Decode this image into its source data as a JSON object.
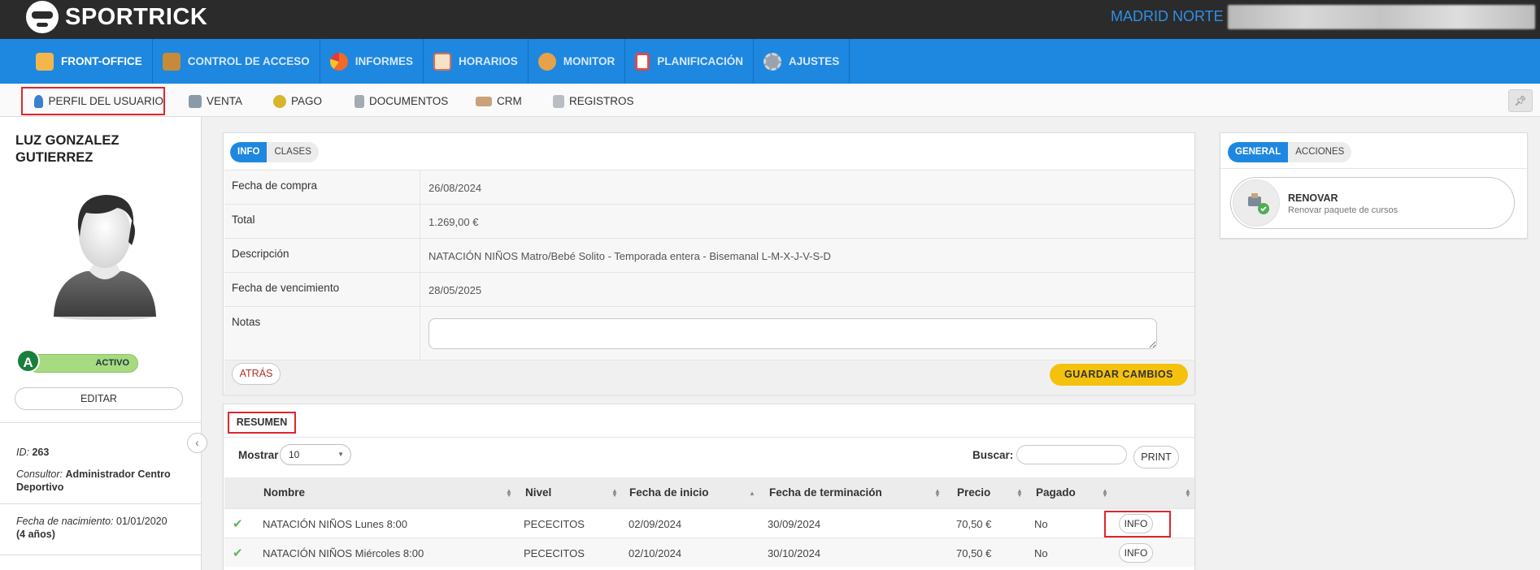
{
  "app": {
    "logo_text": "SPORTRICK",
    "site": "MADRID NORTE"
  },
  "main_nav": [
    {
      "label": "FRONT-OFFICE",
      "icon": "front-office-icon",
      "color": "#f2b64c"
    },
    {
      "label": "CONTROL DE ACCESO",
      "icon": "access-control-icon",
      "color": "#c58b3a"
    },
    {
      "label": "INFORMES",
      "icon": "pie-chart-icon",
      "color": "#f26a2a"
    },
    {
      "label": "HORARIOS",
      "icon": "calendar-icon",
      "color": "#e46b4b"
    },
    {
      "label": "MONITOR",
      "icon": "people-icon",
      "color": "#e6a24a"
    },
    {
      "label": "PLANIFICACIÓN",
      "icon": "planner-icon",
      "color": "#e04a4a"
    },
    {
      "label": "AJUSTES",
      "icon": "gear-icon",
      "color": "#9aa3ad"
    }
  ],
  "sub_nav": [
    {
      "label": "PERFIL DEL USUARIO",
      "icon": "user-profile-icon"
    },
    {
      "label": "VENTA",
      "icon": "sale-icon"
    },
    {
      "label": "PAGO",
      "icon": "coin-icon"
    },
    {
      "label": "DOCUMENTOS",
      "icon": "document-icon"
    },
    {
      "label": "CRM",
      "icon": "handshake-icon"
    },
    {
      "label": "REGISTROS",
      "icon": "records-icon"
    }
  ],
  "user": {
    "name": "LUZ GONZALEZ GUTIERREZ",
    "status_letter": "A",
    "status": "ACTIVO",
    "edit_label": "EDITAR",
    "id_label": "ID:",
    "id": "263",
    "consultant_label": "Consultor:",
    "consultant": "Administrador Centro Deportivo",
    "birth_label": "Fecha de nacimiento:",
    "birth_date": "01/01/2020",
    "age": "(4 años)"
  },
  "info_card": {
    "tabs": [
      "INFO",
      "CLASES"
    ],
    "rows": [
      {
        "label": "Fecha de compra",
        "value": "26/08/2024"
      },
      {
        "label": "Total",
        "value": "1.269,00 €"
      },
      {
        "label": "Descripción",
        "value": "NATACIÓN NIÑOS Matro/Bebé Solito - Temporada entera - Bisemanal L-M-X-J-V-S-D"
      },
      {
        "label": "Fecha de vencimiento",
        "value": "28/05/2025"
      }
    ],
    "notes_label": "Notas",
    "notes_value": "",
    "back_label": "ATRÁS",
    "save_label": "GUARDAR CAMBIOS"
  },
  "summary": {
    "title": "RESUMEN",
    "show_label": "Mostrar",
    "page_size": "10",
    "search_label": "Buscar:",
    "search_value": "",
    "print_label": "PRINT",
    "columns": [
      "Nombre",
      "Nivel",
      "Fecha de inicio",
      "Fecha de terminación",
      "Precio",
      "Pagado"
    ],
    "rows": [
      {
        "nombre": "NATACIÓN NIÑOS Lunes 8:00",
        "nivel": "PECECITOS",
        "inicio": "02/09/2024",
        "fin": "30/09/2024",
        "precio": "70,50 €",
        "pagado": "No",
        "action": "INFO"
      },
      {
        "nombre": "NATACIÓN NIÑOS Miércoles 8:00",
        "nivel": "PECECITOS",
        "inicio": "02/10/2024",
        "fin": "30/10/2024",
        "precio": "70,50 €",
        "pagado": "No",
        "action": "INFO"
      }
    ]
  },
  "actions_card": {
    "tabs": [
      "GENERAL",
      "ACCIONES"
    ],
    "renew_title": "RENOVAR",
    "renew_subtitle": "Renovar paquete de cursos"
  },
  "colors": {
    "topbar": "#2b2b2b",
    "nav": "#1e87e0",
    "accent": "#2f8fe8",
    "save": "#f4c10d",
    "highlight": "#e0262b",
    "active": "#a6db7f"
  }
}
